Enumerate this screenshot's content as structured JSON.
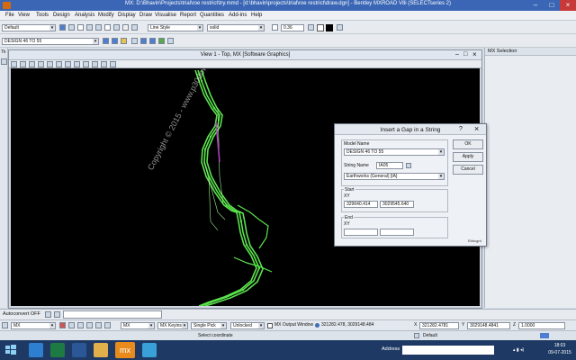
{
  "window": {
    "title": "MX: D:\\Bhavin\\Projects\\trial\\roe restrict\\try.mmd - [d:\\bhavin\\projects\\trial\\roe restrict\\draw.dgn] - Bentley MXROAD V8i (SELECTseries 2)"
  },
  "menu": [
    "File",
    "View",
    "Tools",
    "Design",
    "Analysis",
    "Modify",
    "Display",
    "Draw",
    "Visualise",
    "Report",
    "Quantities",
    "Add-ins",
    "Help"
  ],
  "toolbar1": {
    "level": "Default",
    "line_style": "Line Style",
    "linestyle_value": "solid",
    "weight": "0.36"
  },
  "toolbar2": {
    "model": "DESIGN 46 TO 55"
  },
  "view": {
    "title": "View 1 - Top, MX [Software Graphics]"
  },
  "watermark": "Copyright © 2015 - www.p30download.com",
  "right_panel": {
    "title": "MX Selection"
  },
  "dialog": {
    "title": "Insert a Gap in a String",
    "help": "?",
    "model_label": "Model Name",
    "model_value": "DESIGN 46 TO 55",
    "string_label": "String Name",
    "string_value": "IA05",
    "string_desc": "Earthworks (General) [IA]",
    "start_label": "Start",
    "start_xy_label": "XY",
    "start_x": "329640.414",
    "start_y": "3029545.640",
    "end_label": "End",
    "end_xy_label": "XY",
    "end_x": "",
    "end_y": "",
    "ok": "OK",
    "apply": "Apply",
    "cancel": "Cancel",
    "footer": "Ebbcgrd"
  },
  "status1": {
    "autoconvert": "Autoconvert OFF"
  },
  "status2": {
    "mode": "MX",
    "mx2": "MX",
    "keyins": "MX Keyins",
    "single_pick": "Single Pick",
    "unlocked": "Unlocked",
    "output_window": "MX Output Window",
    "coords": "321282.478, 3029148.484",
    "x_value": "321282.4781",
    "y_value": "3029148.4841",
    "z_value": "1.0000"
  },
  "status3": {
    "prompt": "Select coordinate",
    "level": "Default"
  },
  "taskbar": {
    "address_label": "Address",
    "time": "18:03",
    "date": "09-07-2015",
    "apps": [
      {
        "icon": "start-icon",
        "color": "#2b5797"
      },
      {
        "icon": "ie-icon",
        "color": "#2f7fd1"
      },
      {
        "icon": "excel-icon",
        "color": "#1e7a43"
      },
      {
        "icon": "word-icon",
        "color": "#2b5797"
      },
      {
        "icon": "folder-icon",
        "color": "#e2b04a"
      },
      {
        "icon": "mx-icon",
        "color": "#e88a1c"
      },
      {
        "icon": "bentley-icon",
        "color": "#3aa0d8"
      }
    ],
    "mx_label": "mx"
  }
}
